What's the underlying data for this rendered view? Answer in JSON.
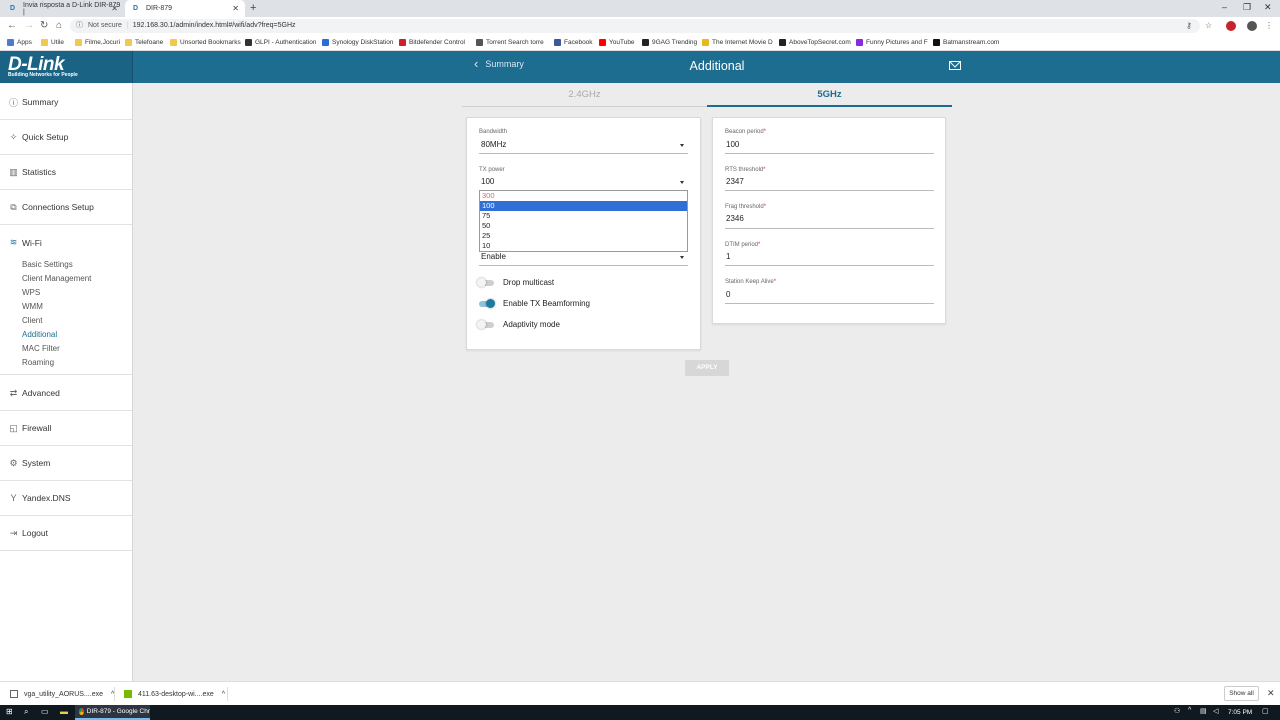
{
  "browser": {
    "tabs": [
      {
        "label": "Invia risposta a D-Link DIR-879 |",
        "favicon": "D"
      },
      {
        "label": "DIR-879",
        "favicon": "D"
      }
    ],
    "address": {
      "security": "Not secure",
      "url": "192.168.30.1/admin/index.html#/wifi/adv?freq=5GHz"
    },
    "bookmarks": [
      "Apps",
      "Utile",
      "Filme,Jocuri",
      "Telefoane",
      "Unsorted Bookmarks",
      "GLPI - Authentication",
      "Synology DiskStation",
      "Bitdefender Control",
      "Torrent Search torre",
      "Facebook",
      "YouTube",
      "9GAG Trending",
      "The Internet Movie D",
      "AboveTopSecret.com",
      "Funny Pictures and F",
      "Batmanstream.com"
    ],
    "bookmark_colors": [
      "#4a7bd6",
      "#f2c94c",
      "#f2c94c",
      "#f2c94c",
      "#f2c94c",
      "#333333",
      "#2a6fd4",
      "#c8232c",
      "#555555",
      "#3b5998",
      "#ff0000",
      "#222222",
      "#e6b91e",
      "#222222",
      "#8a2be2",
      "#111111"
    ]
  },
  "header": {
    "logo": "D-Link",
    "logo_tagline": "Building Networks for People",
    "back_label": "Summary",
    "title": "Additional"
  },
  "sidebar": {
    "items": [
      {
        "label": "Summary",
        "icon": "info-icon"
      },
      {
        "label": "Quick Setup",
        "icon": "wand-icon"
      },
      {
        "label": "Statistics",
        "icon": "bar-chart-icon"
      },
      {
        "label": "Connections Setup",
        "icon": "connections-icon"
      },
      {
        "label": "Wi-Fi",
        "icon": "wifi-icon"
      }
    ],
    "wifi_subitems": [
      "Basic Settings",
      "Client Management",
      "WPS",
      "WMM",
      "Client",
      "Additional",
      "MAC Filter",
      "Roaming"
    ],
    "lower_items": [
      {
        "label": "Advanced",
        "icon": "arrows-icon"
      },
      {
        "label": "Firewall",
        "icon": "firewall-icon"
      },
      {
        "label": "System",
        "icon": "gear-icon"
      },
      {
        "label": "Yandex.DNS",
        "icon": "yandex-icon"
      },
      {
        "label": "Logout",
        "icon": "logout-icon"
      }
    ]
  },
  "freq_tabs": {
    "inactive": "2.4GHz",
    "active": "5GHz"
  },
  "left_card": {
    "bandwidth_label": "Bandwidth",
    "bandwidth_value": "80MHz",
    "tx_power_label": "TX power",
    "tx_power_value": "100",
    "tx_options": [
      "300",
      "100",
      "75",
      "50",
      "25",
      "10"
    ],
    "hidden_select_value": "Enable",
    "toggles": [
      {
        "label": "Drop multicast",
        "on": false
      },
      {
        "label": "Enable TX Beamforming",
        "on": true
      },
      {
        "label": "Adaptivity mode",
        "on": false
      }
    ]
  },
  "right_card": {
    "fields": [
      {
        "label": "Beacon period",
        "value": "100"
      },
      {
        "label": "RTS threshold",
        "value": "2347"
      },
      {
        "label": "Frag threshold",
        "value": "2346"
      },
      {
        "label": "DTIM period",
        "value": "1"
      },
      {
        "label": "Station Keep Alive",
        "value": "0"
      }
    ],
    "required_mark": "*"
  },
  "apply_label": "APPLY",
  "downloads": {
    "items": [
      "vga_utility_AORUS....exe",
      "411.63-desktop-wi....exe"
    ],
    "show_all": "Show all"
  },
  "taskbar": {
    "active_window": "DIR-879 - Google Chr",
    "time": "7:05 PM"
  },
  "colors": {
    "brand": "#1d6d90",
    "selected_option": "#2f6fd6"
  }
}
